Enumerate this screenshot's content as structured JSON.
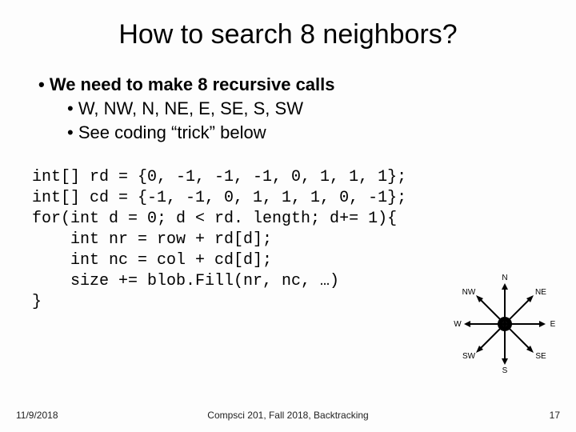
{
  "title": "How to search 8 neighbors?",
  "bullets": {
    "main": "We need to make 8 recursive calls",
    "sub1": "W, NW, N, NE, E, SE, S, SW",
    "sub2": "See coding “trick” below"
  },
  "code": "int[] rd = {0, -1, -1, -1, 0, 1, 1, 1};\nint[] cd = {-1, -1, 0, 1, 1, 1, 0, -1};\nfor(int d = 0; d < rd. length; d+= 1){\n    int nr = row + rd[d];\n    int nc = col + cd[d];\n    size += blob.Fill(nr, nc, …)\n}",
  "compass": {
    "labels": [
      "N",
      "NE",
      "E",
      "SE",
      "S",
      "SW",
      "W",
      "NW"
    ]
  },
  "footer": {
    "date": "11/9/2018",
    "center": "Compsci 201, Fall 2018,  Backtracking",
    "page": "17"
  }
}
